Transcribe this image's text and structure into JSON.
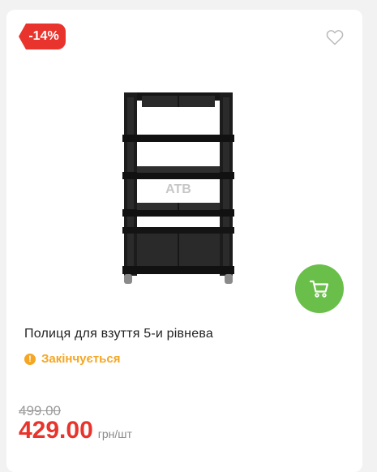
{
  "card": {
    "discount_badge": "-14%",
    "favorite_icon": "heart-outline-icon",
    "cart_icon": "shopping-cart-icon",
    "product_image": "black plastic shoe shelf, 5 tiers",
    "watermark": "ATB",
    "title": "Полиця для взуття 5-и рівнева",
    "stock_status": "Закінчується",
    "stock_icon": "exclamation-circle-icon",
    "old_price": "499.00",
    "price": "429.00",
    "unit": "грн/шт"
  },
  "colors": {
    "badge": "#e8342c",
    "price": "#e8342c",
    "cart_button": "#6abf4b",
    "stock_warning": "#f5a623",
    "old_price": "#9a9a9a"
  }
}
